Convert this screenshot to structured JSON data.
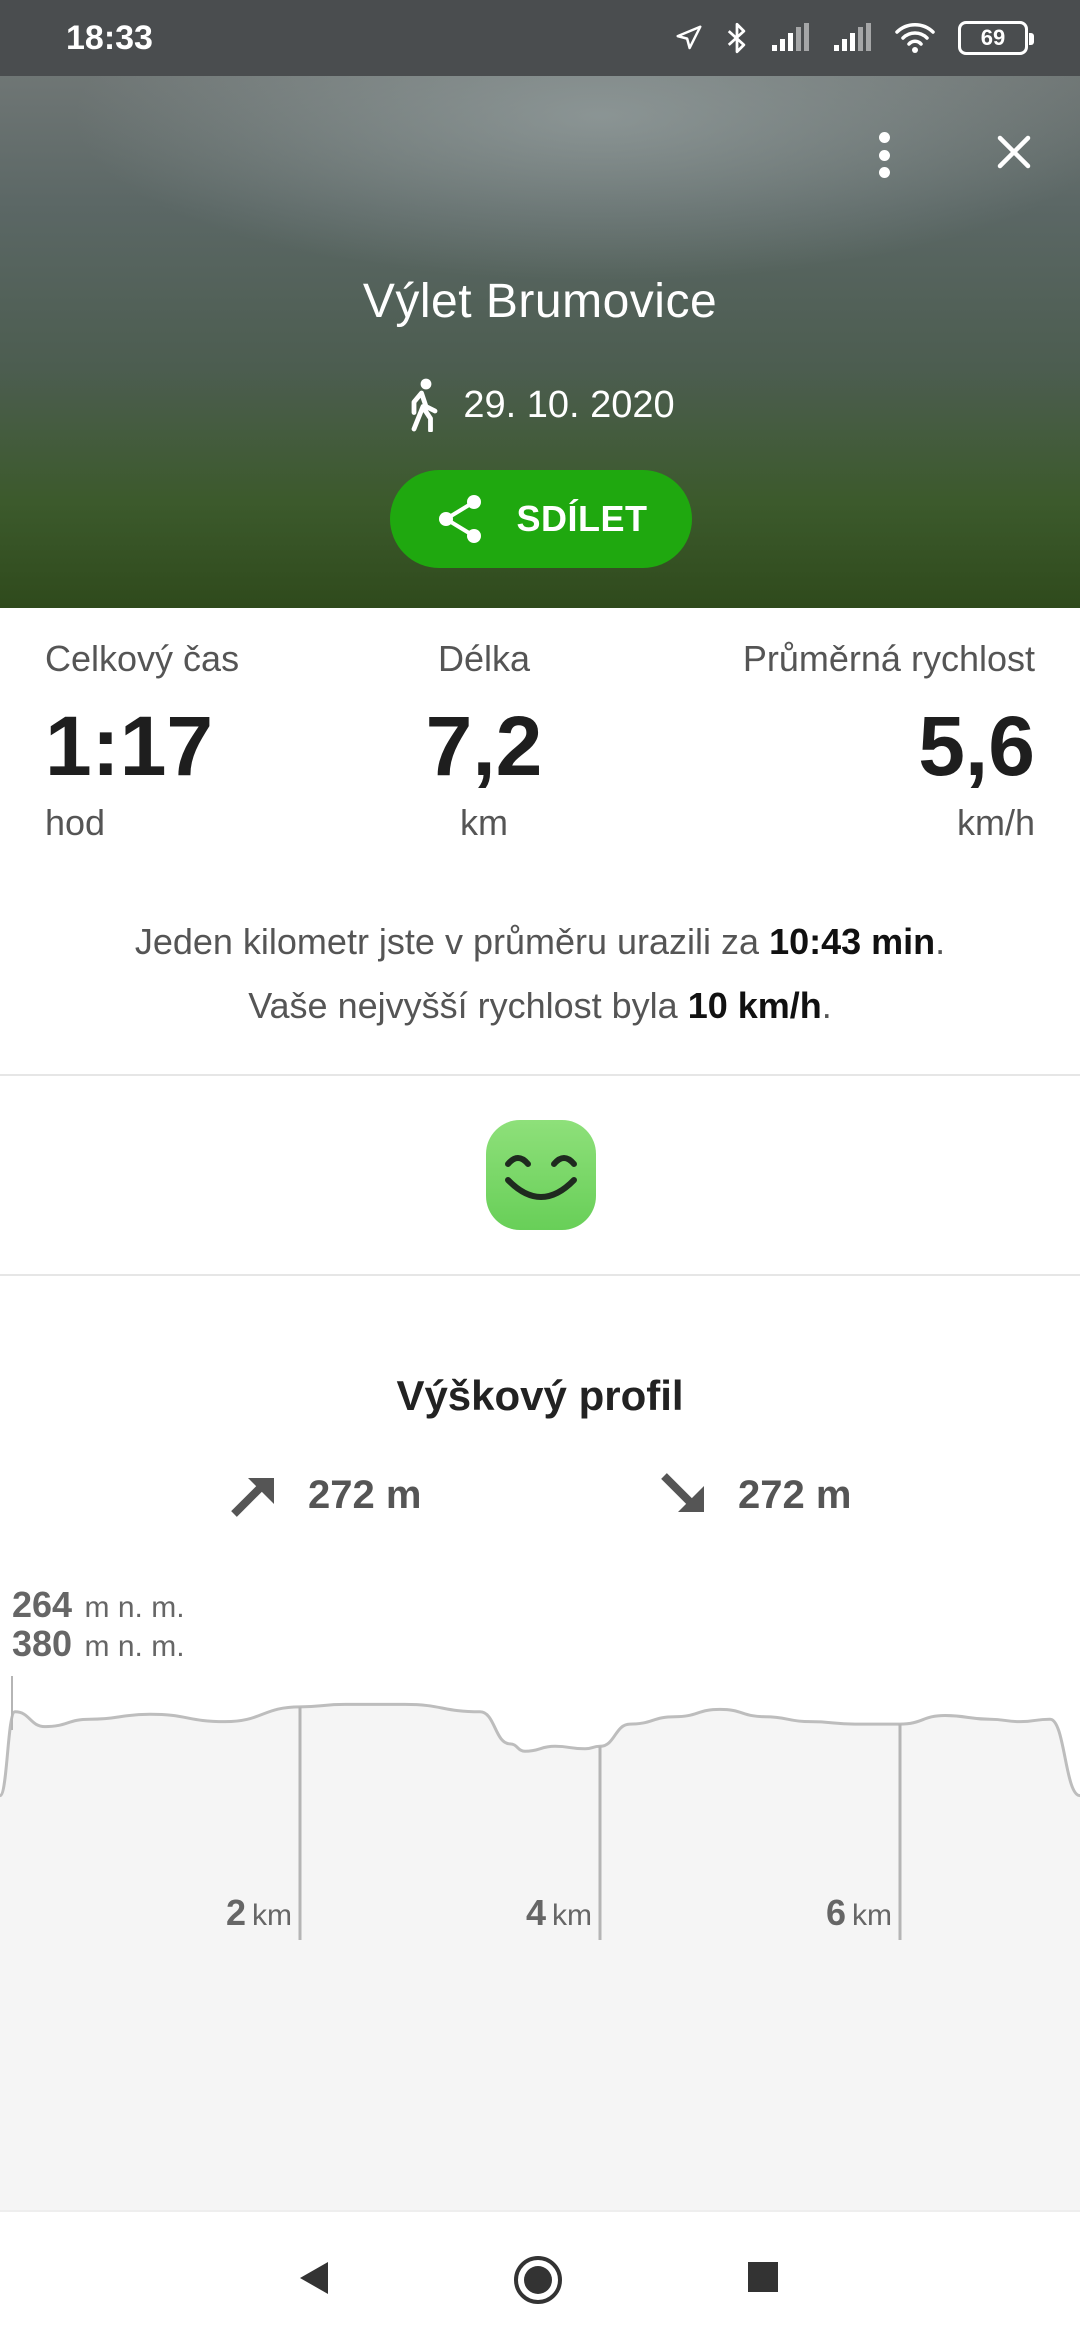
{
  "status_bar": {
    "time": "18:33",
    "battery": "69",
    "icons": [
      "location-arrow-icon",
      "bluetooth-icon",
      "signal-icon",
      "signal-icon",
      "wifi-icon",
      "battery-icon"
    ]
  },
  "header": {
    "title": "Výlet Brumovice",
    "activity_icon": "walking-icon",
    "date": "29. 10. 2020",
    "share_label": "SDÍLET",
    "menu_icon": "more-vert-icon",
    "close_icon": "close-icon"
  },
  "stats": [
    {
      "label": "Celkový čas",
      "value": "1:17",
      "unit": "hod"
    },
    {
      "label": "Délka",
      "value": "7,2",
      "unit": "km"
    },
    {
      "label": "Průměrná rychlost",
      "value": "5,6",
      "unit": "km/h"
    }
  ],
  "summary": {
    "line1_prefix": "Jeden kilometr jste v průměru urazili za ",
    "line1_value": "10:43 min",
    "line1_suffix": ".",
    "line2_prefix": "Vaše nejvyšší rychlost byla ",
    "line2_value": "10 km/h",
    "line2_suffix": "."
  },
  "mood": {
    "icon": "smiling-face-icon"
  },
  "elevation": {
    "title": "Výškový profil",
    "ascent": "272 m",
    "descent": "272 m",
    "ascent_icon": "arrow-up-right-icon",
    "descent_icon": "arrow-down-right-icon",
    "min_label_value": "264",
    "max_label_value": "380",
    "alt_unit": "m n. m."
  },
  "chart_data": {
    "type": "area",
    "x_unit": "km",
    "x_ticks": [
      2,
      4,
      6
    ],
    "x_tick_unit_label": "km",
    "x": [
      0,
      0.1,
      0.3,
      0.6,
      1.0,
      1.5,
      2.0,
      2.3,
      2.7,
      3.2,
      3.4,
      3.5,
      3.7,
      3.9,
      4.0,
      4.2,
      4.5,
      4.8,
      5.1,
      5.4,
      5.7,
      6.0,
      6.3,
      6.6,
      6.8,
      7.0,
      7.2
    ],
    "y": [
      300,
      368,
      356,
      362,
      366,
      360,
      372,
      374,
      374,
      368,
      342,
      336,
      340,
      338,
      340,
      358,
      364,
      370,
      364,
      360,
      358,
      358,
      365,
      362,
      360,
      362,
      300
    ],
    "y_unit": "m n. m.",
    "ylim": [
      264,
      380
    ],
    "grid": false
  },
  "nav": {
    "back_icon": "back-triangle-icon",
    "home_icon": "home-circle-icon",
    "recents_icon": "recents-square-icon"
  }
}
